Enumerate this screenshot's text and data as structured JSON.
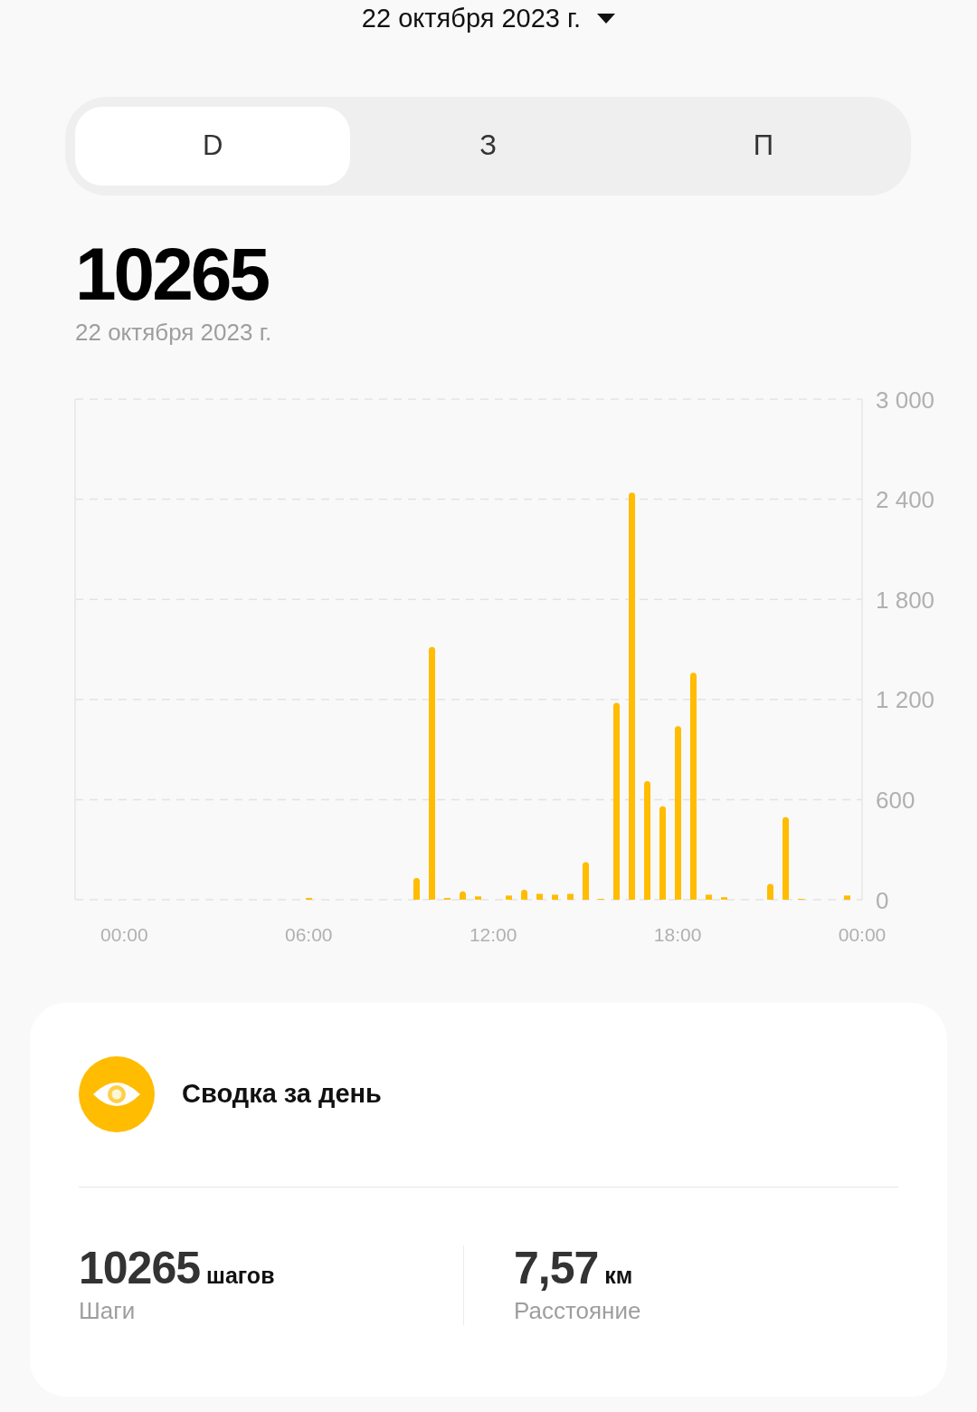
{
  "header": {
    "date": "22 октября 2023 г."
  },
  "period_tabs": [
    {
      "label": "D",
      "selected": true
    },
    {
      "label": "З",
      "selected": false
    },
    {
      "label": "П",
      "selected": false
    }
  ],
  "summary": {
    "total": "10265",
    "date": "22 октября 2023 г."
  },
  "chart": {
    "chart_data": {
      "type": "bar",
      "x": [
        6,
        9.5,
        10,
        10.5,
        11,
        11.5,
        12.5,
        13,
        13.5,
        14,
        14.5,
        15,
        15.5,
        16,
        16.5,
        17,
        17.5,
        18,
        18.5,
        19,
        19.5,
        21,
        21.5,
        22,
        23.5
      ],
      "series": [
        {
          "color": "#ffbc00",
          "values": [
            10,
            130,
            1515,
            10,
            50,
            20,
            25,
            60,
            35,
            30,
            35,
            225,
            5,
            1180,
            2440,
            710,
            560,
            1040,
            1360,
            30,
            15,
            95,
            495,
            5,
            25
          ]
        }
      ],
      "xlim": [
        -1.6,
        24
      ],
      "ylim": [
        0,
        3000
      ],
      "grid": true,
      "yticks": [
        {
          "value": 0,
          "label": "0"
        },
        {
          "value": 600,
          "label": "600"
        },
        {
          "value": 1200,
          "label": "1 200"
        },
        {
          "value": 1800,
          "label": "1 800"
        },
        {
          "value": 2400,
          "label": "2 400"
        },
        {
          "value": 3000,
          "label": "3 000"
        }
      ],
      "xticks": [
        {
          "value": 0,
          "label": "00:00"
        },
        {
          "value": 6,
          "label": "06:00"
        },
        {
          "value": 12,
          "label": "12:00"
        },
        {
          "value": 18,
          "label": "18:00"
        },
        {
          "value": 24,
          "label": "00:00"
        }
      ]
    }
  },
  "daily_card": {
    "title": "Сводка за день",
    "stats": [
      {
        "value": "10265",
        "unit": "шагов",
        "label": "Шаги"
      },
      {
        "value": "7,57",
        "unit": "км",
        "label": "Расстояние"
      }
    ]
  }
}
